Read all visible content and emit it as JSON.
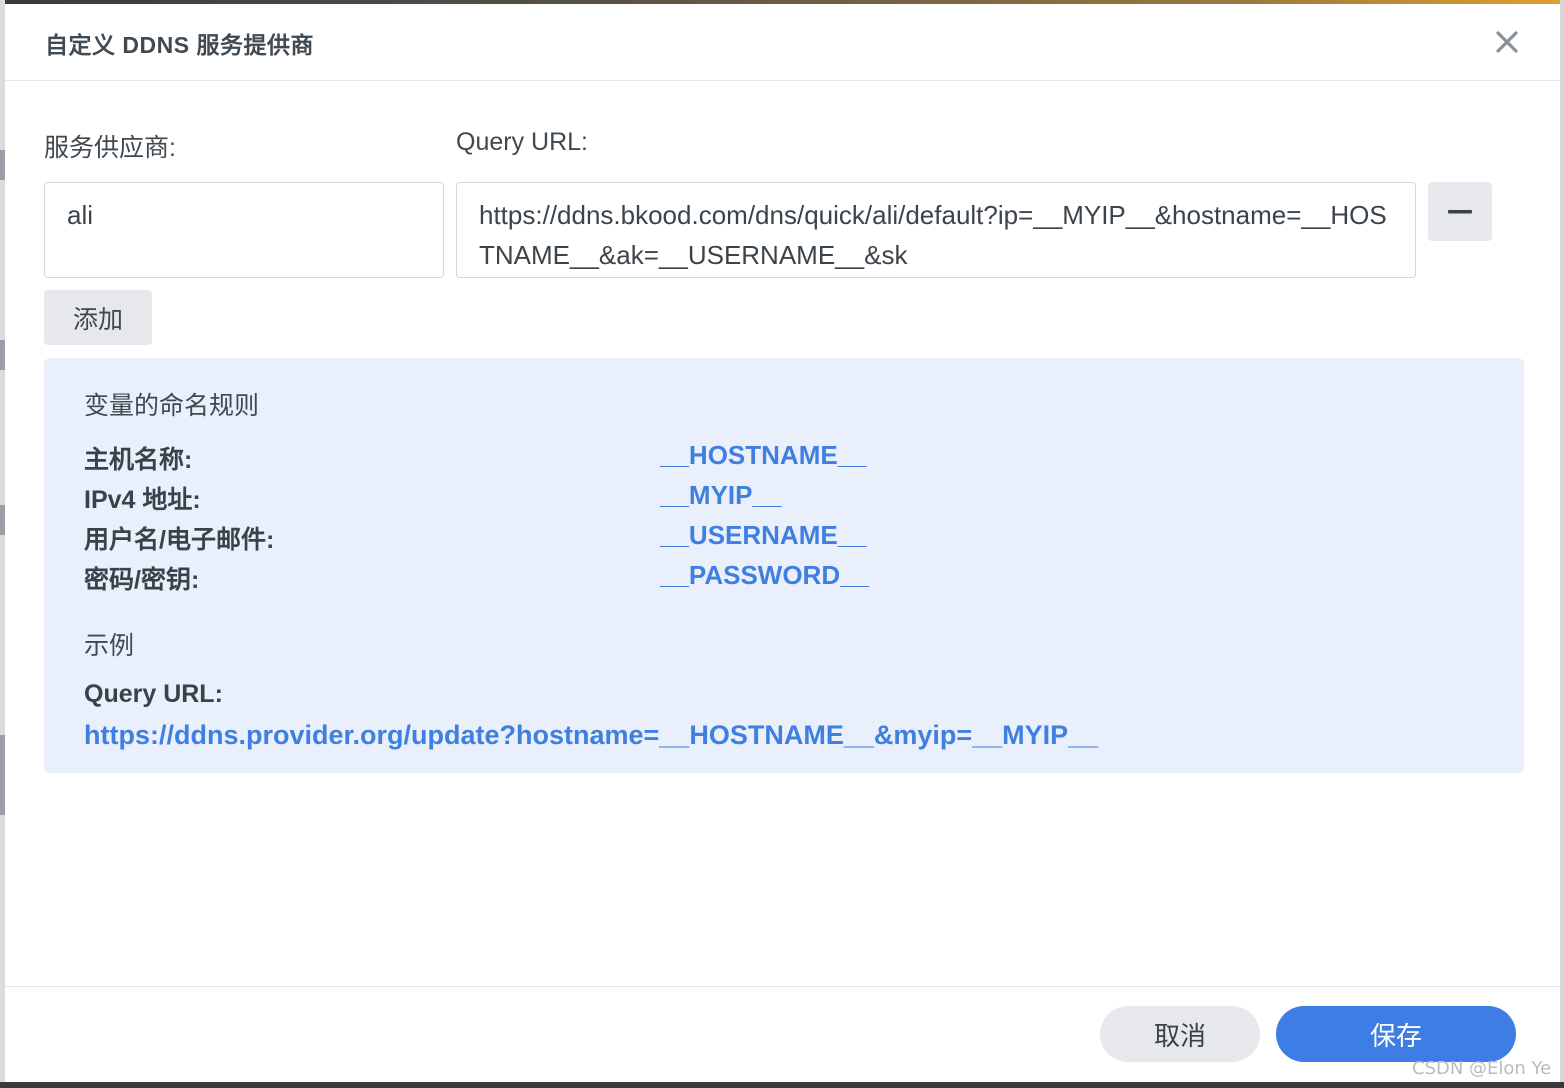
{
  "dialog": {
    "title": "自定义 DDNS 服务提供商"
  },
  "form": {
    "provider_label": "服务供应商:",
    "provider_value": "ali",
    "query_url_label": "Query URL:",
    "query_url_value": "https://ddns.bkood.com/dns/quick/ali/default?ip=__MYIP__&hostname=__HOSTNAME__&ak=__USERNAME__&sk",
    "add_button": "添加"
  },
  "info": {
    "naming_rules_heading": "变量的命名规则",
    "variables": [
      {
        "label": "主机名称:",
        "value": "__HOSTNAME__"
      },
      {
        "label": "IPv4 地址:",
        "value": "__MYIP__"
      },
      {
        "label": "用户名/电子邮件:",
        "value": "__USERNAME__"
      },
      {
        "label": "密码/密钥:",
        "value": "__PASSWORD__"
      }
    ],
    "example_heading": "示例",
    "example_label": "Query URL:",
    "example_url": "https://ddns.provider.org/update?hostname=__HOSTNAME__&myip=__MYIP__"
  },
  "footer": {
    "cancel_button": "取消",
    "save_button": "保存"
  },
  "watermark": "CSDN @Elon Ye",
  "colors": {
    "accent": "#3e7de4",
    "variable_text": "#3f7fe0",
    "info_background": "#eaf0fb"
  },
  "icons": {
    "close": "close-icon",
    "remove": "minus-icon"
  }
}
